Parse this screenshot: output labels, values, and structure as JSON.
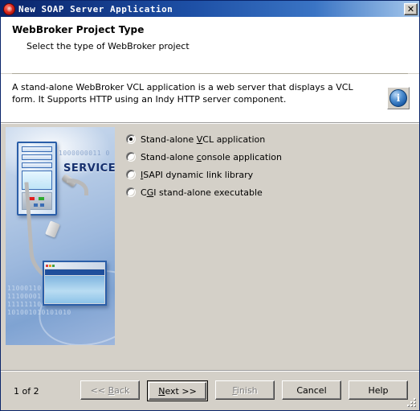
{
  "window": {
    "title": "New SOAP Server Application",
    "app_icon": "delphi-app-icon",
    "close_label": "✕"
  },
  "header": {
    "title": "WebBroker Project Type",
    "subtitle": "Select the type of WebBroker project"
  },
  "description": {
    "text": "A stand-alone WebBroker VCL application is a web server that displays a VCL form. It Supports HTTP using an Indy HTTP server component.",
    "info_icon_glyph": "i"
  },
  "side_image": {
    "service_label": "SERVICE",
    "binary_top": "1000000011 0",
    "binary_bottom": "11000110\n11100001\n11111110\n101001010101010"
  },
  "project_types": {
    "selected_index": 0,
    "options": [
      {
        "pre": "Stand-alone ",
        "accel": "V",
        "post": "CL application",
        "full": "Stand-alone VCL application",
        "selected": true
      },
      {
        "pre": "Stand-alone ",
        "accel": "c",
        "post": "onsole application",
        "full": "Stand-alone console application",
        "selected": false
      },
      {
        "pre": "",
        "accel": "I",
        "post": "SAPI dynamic link library",
        "full": "ISAPI dynamic link library",
        "selected": false
      },
      {
        "pre": "C",
        "accel": "G",
        "post": "I stand-alone executable",
        "full": "CGI stand-alone executable",
        "selected": false
      }
    ]
  },
  "footer": {
    "page_count": "1 of 2",
    "buttons": [
      {
        "pre": "<< ",
        "accel": "B",
        "post": "ack",
        "full": "<< Back",
        "state": "disabled"
      },
      {
        "pre": "",
        "accel": "N",
        "post": "ext >>",
        "full": "Next >>",
        "state": "default"
      },
      {
        "pre": "",
        "accel": "F",
        "post": "inish",
        "full": "Finish",
        "state": "disabled"
      },
      {
        "pre": "",
        "accel": "",
        "post": "Cancel",
        "full": "Cancel",
        "state": "normal"
      },
      {
        "pre": "",
        "accel": "",
        "post": "Help",
        "full": "Help",
        "state": "normal"
      }
    ]
  },
  "colors": {
    "face": "#d4d0c8",
    "title_start": "#0a246a",
    "title_end": "#a6c8ec",
    "panel_white": "#ffffff",
    "service_blue": "#16306e"
  }
}
